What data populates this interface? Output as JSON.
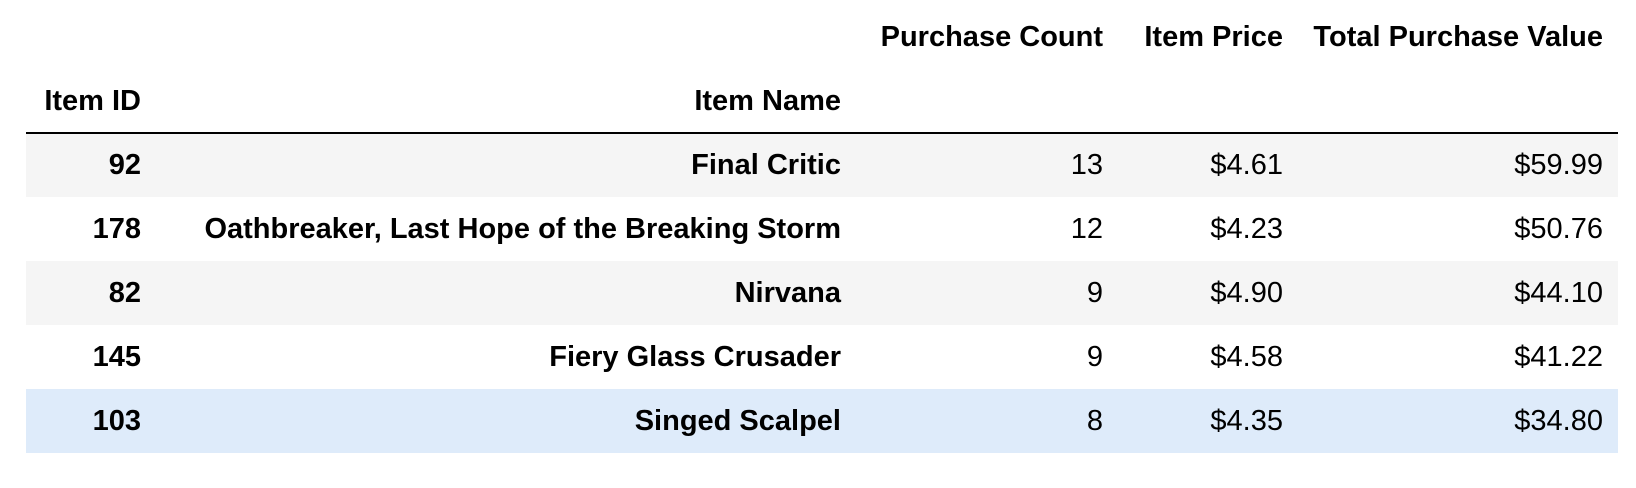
{
  "table": {
    "column_headers": [
      "Purchase Count",
      "Item Price",
      "Total Purchase Value"
    ],
    "index_headers": [
      "Item ID",
      "Item Name"
    ],
    "rows": [
      {
        "item_id": "92",
        "item_name": "Final Critic",
        "purchase_count": "13",
        "item_price": "$4.61",
        "total_purchase_value": "$59.99"
      },
      {
        "item_id": "178",
        "item_name": "Oathbreaker, Last Hope of the Breaking Storm",
        "purchase_count": "12",
        "item_price": "$4.23",
        "total_purchase_value": "$50.76"
      },
      {
        "item_id": "82",
        "item_name": "Nirvana",
        "purchase_count": "9",
        "item_price": "$4.90",
        "total_purchase_value": "$44.10"
      },
      {
        "item_id": "145",
        "item_name": "Fiery Glass Crusader",
        "purchase_count": "9",
        "item_price": "$4.58",
        "total_purchase_value": "$41.22"
      },
      {
        "item_id": "103",
        "item_name": "Singed Scalpel",
        "purchase_count": "8",
        "item_price": "$4.35",
        "total_purchase_value": "$34.80"
      }
    ]
  },
  "colors": {
    "striped_row": "#f5f5f5",
    "hovered_row": "#deebfa",
    "header_rule": "#000000"
  }
}
